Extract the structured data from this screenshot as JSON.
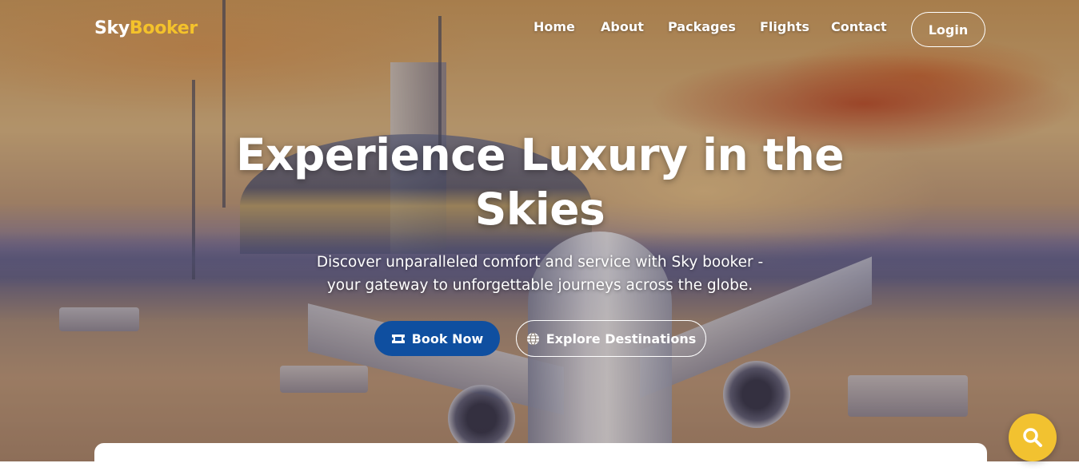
{
  "brand": {
    "part1": "Sky",
    "part2": "Booker",
    "accent_color": "#f4c22b"
  },
  "nav": {
    "items": [
      {
        "label": "Home"
      },
      {
        "label": "About"
      },
      {
        "label": "Packages"
      },
      {
        "label": "Flights"
      },
      {
        "label": "Contact"
      }
    ],
    "login_label": "Login"
  },
  "hero": {
    "title_line1": "Experience Luxury in the",
    "title_line2": "Skies",
    "subtitle_line1": "Discover unparalleled comfort and service with Sky booker -",
    "subtitle_line2": "your gateway to unforgettable journeys across the globe.",
    "primary_button": {
      "label": "Book Now",
      "icon": "ticket-icon",
      "color": "#0f4fa0"
    },
    "secondary_button": {
      "label": "Explore Destinations",
      "icon": "globe-icon"
    }
  },
  "floating_button": {
    "icon": "search-icon",
    "color": "#f2c230"
  }
}
